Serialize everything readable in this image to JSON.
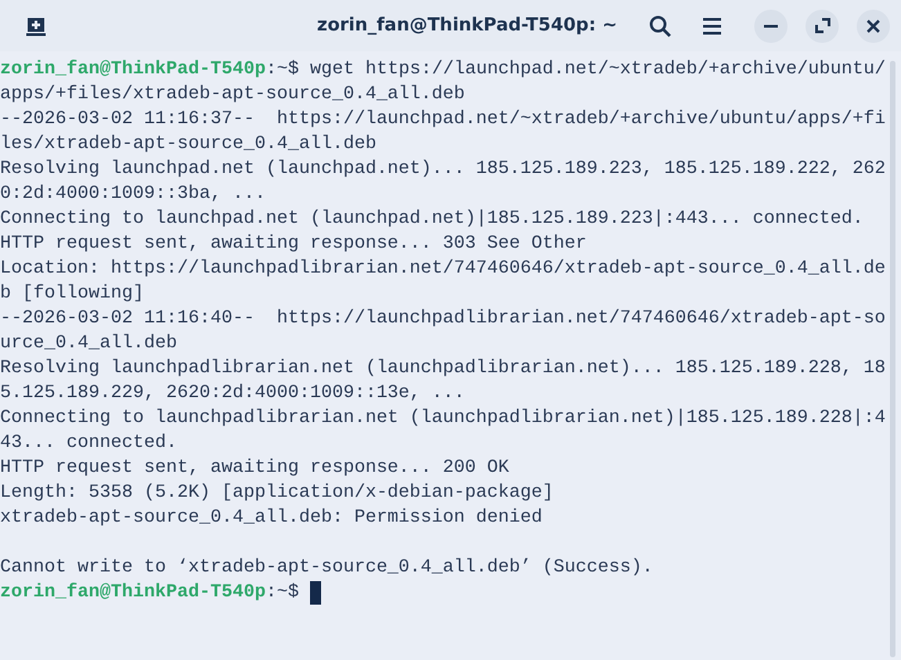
{
  "window": {
    "title": "zorin_fan@ThinkPad-T540p: ~"
  },
  "terminal": {
    "lines": [
      {
        "kind": "prompt",
        "user": "zorin_fan@ThinkPad-T540p",
        "path": ":~$",
        "command": " wget https://launchpad.net/~xtradeb/+archive/ubuntu/apps/+files/xtradeb-apt-source_0.4_all.deb",
        "cursor": false
      },
      {
        "kind": "output",
        "text": "--2026-03-02 11:16:37--  https://launchpad.net/~xtradeb/+archive/ubuntu/apps/+files/xtradeb-apt-source_0.4_all.deb"
      },
      {
        "kind": "output",
        "text": "Resolving launchpad.net (launchpad.net)... 185.125.189.223, 185.125.189.222, 2620:2d:4000:1009::3ba, ..."
      },
      {
        "kind": "output",
        "text": "Connecting to launchpad.net (launchpad.net)|185.125.189.223|:443... connected."
      },
      {
        "kind": "output",
        "text": "HTTP request sent, awaiting response... 303 See Other"
      },
      {
        "kind": "output",
        "text": "Location: https://launchpadlibrarian.net/747460646/xtradeb-apt-source_0.4_all.deb [following]"
      },
      {
        "kind": "output",
        "text": "--2026-03-02 11:16:40--  https://launchpadlibrarian.net/747460646/xtradeb-apt-source_0.4_all.deb"
      },
      {
        "kind": "output",
        "text": "Resolving launchpadlibrarian.net (launchpadlibrarian.net)... 185.125.189.228, 185.125.189.229, 2620:2d:4000:1009::13e, ..."
      },
      {
        "kind": "output",
        "text": "Connecting to launchpadlibrarian.net (launchpadlibrarian.net)|185.125.189.228|:443... connected."
      },
      {
        "kind": "output",
        "text": "HTTP request sent, awaiting response... 200 OK"
      },
      {
        "kind": "output",
        "text": "Length: 5358 (5.2K) [application/x-debian-package]"
      },
      {
        "kind": "output",
        "text": "xtradeb-apt-source_0.4_all.deb: Permission denied"
      },
      {
        "kind": "blank"
      },
      {
        "kind": "output",
        "text": "Cannot write to ‘xtradeb-apt-source_0.4_all.deb’ (Success)."
      },
      {
        "kind": "prompt",
        "user": "zorin_fan@ThinkPad-T540p",
        "path": ":~$ ",
        "cursor": true
      }
    ]
  }
}
